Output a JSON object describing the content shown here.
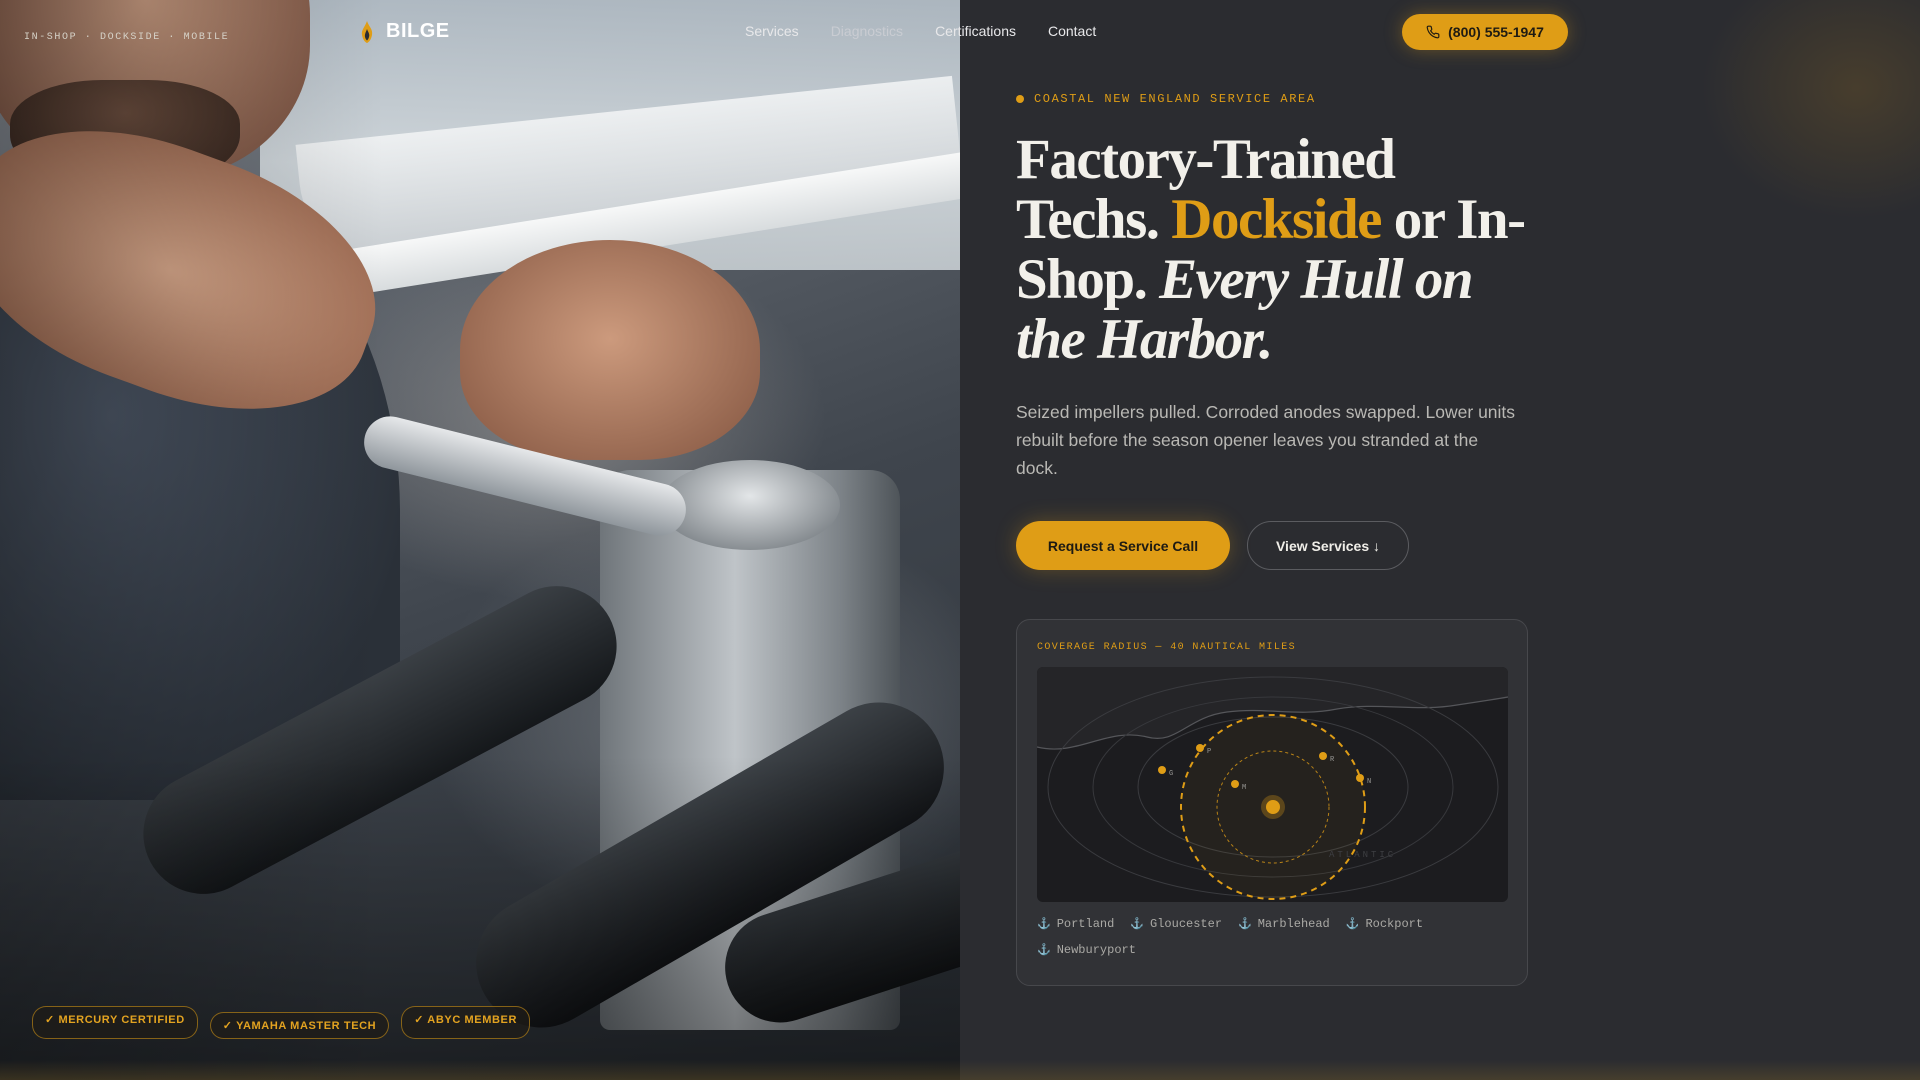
{
  "site": {
    "tagline": "IN-SHOP · DOCKSIDE · MOBILE",
    "brand": "BILGE"
  },
  "nav": {
    "links": [
      "Services",
      "Diagnostics",
      "Certifications",
      "Contact"
    ],
    "phone": "(800) 555-1947"
  },
  "hero": {
    "eyebrow": "COASTAL NEW ENGLAND SERVICE AREA",
    "headline": {
      "part1": "Factory-Trained Techs. ",
      "accent": "Dockside",
      "part2": " or In-Shop. ",
      "italic": "Every Hull on the Harbor."
    },
    "lede": "Seized impellers pulled. Corroded anodes swapped. Lower units rebuilt before the season opener leaves you stranded at the dock.",
    "primary_cta": "Request a Service Call",
    "secondary_cta": "View Services ↓"
  },
  "coverage": {
    "label": "COVERAGE RADIUS — 40 NAUTICAL MILES",
    "sea_label": "ATLANTIC",
    "map_markers": [
      "P",
      "G",
      "M",
      "R",
      "N"
    ],
    "towns": [
      "Portland",
      "Gloucester",
      "Marblehead",
      "Rockport",
      "Newburyport"
    ]
  },
  "badges": [
    "✓ MERCURY CERTIFIED",
    "✓ YAMAHA MASTER TECH",
    "✓ ABYC MEMBER"
  ],
  "colors": {
    "accent": "#df9d16",
    "background": "#2b2c30",
    "card": "#313236"
  },
  "icons": {
    "phone": "phone-icon",
    "logo": "flame-icon",
    "town": "anchor-icon"
  }
}
